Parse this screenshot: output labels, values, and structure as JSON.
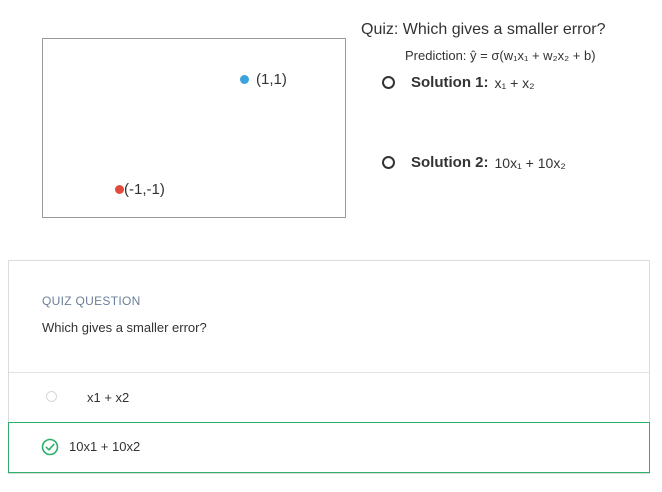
{
  "slide": {
    "points": [
      {
        "label": "(1,1)",
        "color": "#3aa3dc"
      },
      {
        "label": "(-1,-1)",
        "color": "#e2493c"
      }
    ],
    "quiz_title": "Quiz: Which gives a smaller error?",
    "prediction": "Prediction: ŷ = σ(w₁x₁ + w₂x₂ + b)",
    "options": [
      {
        "bold": "Solution 1:",
        "expr": "x₁ + x₂"
      },
      {
        "bold": "Solution 2:",
        "expr": "10x₁ + 10x₂"
      }
    ]
  },
  "question": {
    "kicker": "QUIZ QUESTION",
    "text": "Which gives a smaller error?",
    "answers": [
      {
        "label": "x1 + x2",
        "selected": false
      },
      {
        "label": "10x1 + 10x2",
        "selected": true
      }
    ],
    "accent": "#2eae6b"
  }
}
